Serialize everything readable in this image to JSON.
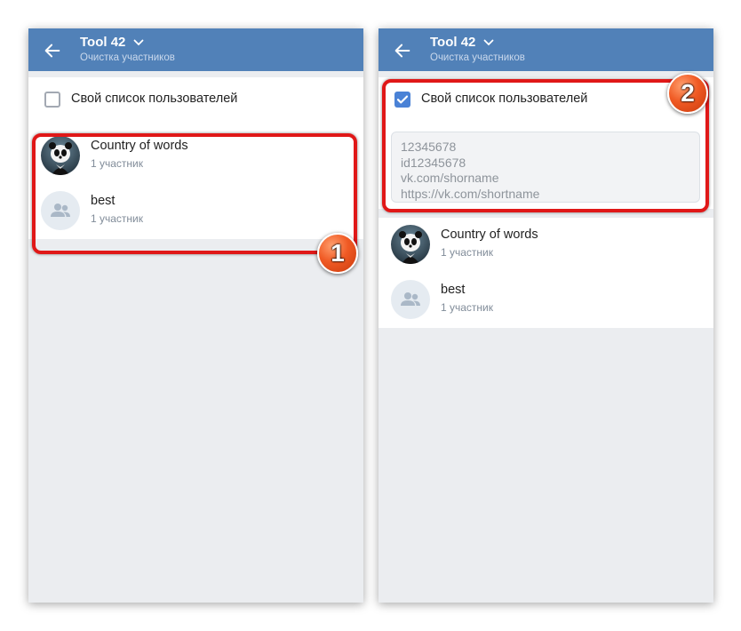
{
  "left": {
    "header": {
      "title": "Tool 42",
      "subtitle": "Очистка участников"
    },
    "custom_list": {
      "label": "Свой список пользователей",
      "checked": false
    },
    "chats": [
      {
        "name": "Country of words",
        "members": "1 участник",
        "avatar": "panda-avatar"
      },
      {
        "name": "best",
        "members": "1 участник",
        "avatar": "group-icon"
      }
    ],
    "badge": "1"
  },
  "right": {
    "header": {
      "title": "Tool 42",
      "subtitle": "Очистка участников"
    },
    "custom_list": {
      "label": "Свой список пользователей",
      "checked": true
    },
    "users_input": {
      "placeholder_lines": [
        "12345678",
        "id12345678",
        "vk.com/shorname",
        "https://vk.com/shortname"
      ]
    },
    "chats": [
      {
        "name": "Country of words",
        "members": "1 участник",
        "avatar": "panda-avatar"
      },
      {
        "name": "best",
        "members": "1 участник",
        "avatar": "group-icon"
      }
    ],
    "badge": "2"
  },
  "colors": {
    "header": "#5181b8",
    "accent": "#4a82d6",
    "highlight": "#e01818",
    "badge": "#f05a24"
  }
}
